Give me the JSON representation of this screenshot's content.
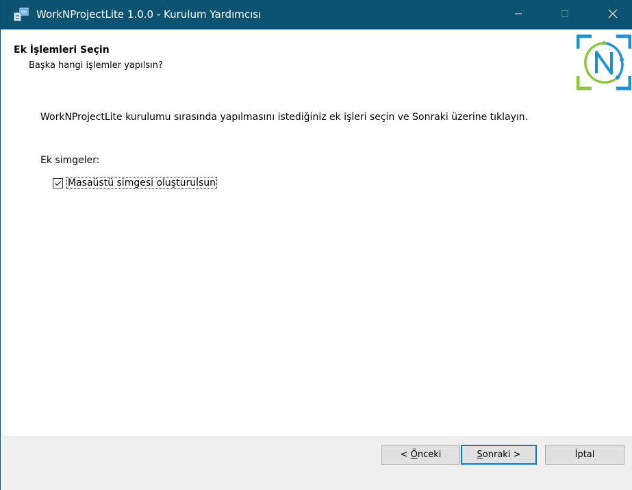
{
  "window": {
    "title": "WorkNProjectLite 1.0.0 - Kurulum Yardımcısı",
    "icon": "installer-icon",
    "controls": {
      "minimize_icon": "minimize-icon",
      "maximize_icon": "maximize-icon",
      "close_icon": "close-icon"
    }
  },
  "header": {
    "title": "Ek İşlemleri Seçin",
    "subtitle": "Başka hangi işlemler yapılsın?",
    "logo": "worknproject-logo"
  },
  "content": {
    "instruction": "WorkNProjectLite kurulumu sırasında yapılmasını istediğiniz ek işleri seçin ve Sonraki üzerine tıklayın.",
    "group_label": "Ek simgeler:",
    "tasks": [
      {
        "label": "Masaüstü simgesi oluşturulsun",
        "checked": true
      }
    ]
  },
  "footer": {
    "back": {
      "prefix": "< ",
      "accel": "Ö",
      "rest": "nceki"
    },
    "next": {
      "accel": "S",
      "rest": "onraki >"
    },
    "cancel": "İptal"
  },
  "colors": {
    "titlebar": "#0b5370",
    "focus_border": "#0078d7",
    "logo_blue": "#1e90d6",
    "logo_green": "#8cc63f"
  }
}
